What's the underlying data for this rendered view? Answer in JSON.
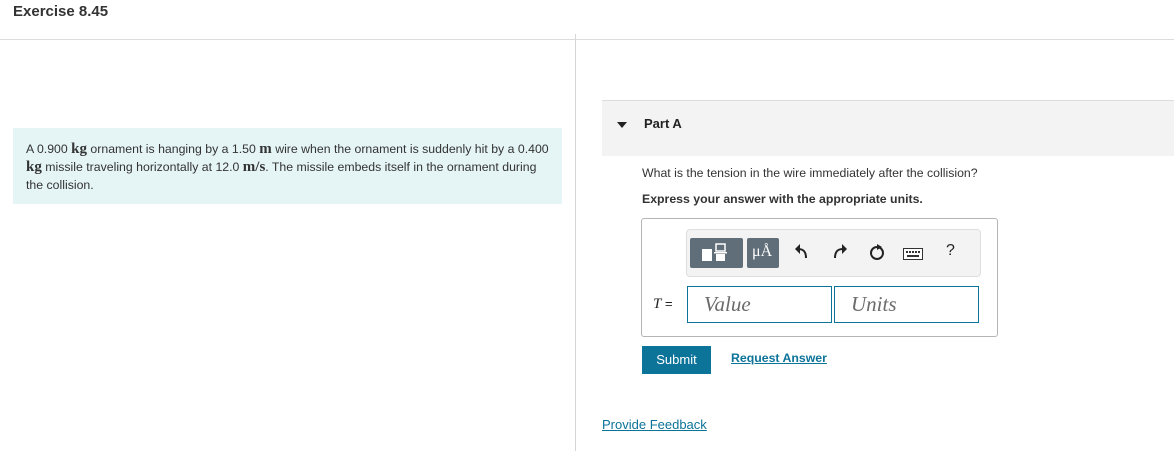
{
  "exercise": {
    "title": "Exercise 8.45"
  },
  "problem": {
    "t1": "A ",
    "mass1": "0.900",
    "unit_kg": "kg",
    "t2": " ornament is hanging by a ",
    "length": "1.50",
    "unit_m": "m",
    "t3": " wire when the ornament is suddenly hit by a ",
    "mass2": "0.400",
    "t4": " missile traveling horizontally at ",
    "speed": "12.0",
    "unit_speed": "m/s",
    "t5": ". The missile embeds itself in the ornament during the collision."
  },
  "part": {
    "label": "Part A"
  },
  "question": "What is the tension in the wire immediately after the collision?",
  "instruction": "Express your answer with the appropriate units.",
  "toolbar": {
    "buttons": [
      "templates-icon",
      "units-mu-angstrom-icon",
      "undo-icon",
      "redo-icon",
      "reset-icon",
      "keyboard-icon",
      "help-icon"
    ],
    "mu_label": "μÅ",
    "help_label": "?"
  },
  "equation": {
    "variable": "T",
    "equals": " ="
  },
  "inputs": {
    "value_placeholder": "Value",
    "units_placeholder": "Units"
  },
  "actions": {
    "submit_label": "Submit",
    "request_answer_label": "Request Answer",
    "feedback_label": "Provide Feedback"
  },
  "colors": {
    "accent": "#0c7399",
    "problem_bg": "#e5f4f5",
    "toolbar_dark": "#5f6e78"
  }
}
